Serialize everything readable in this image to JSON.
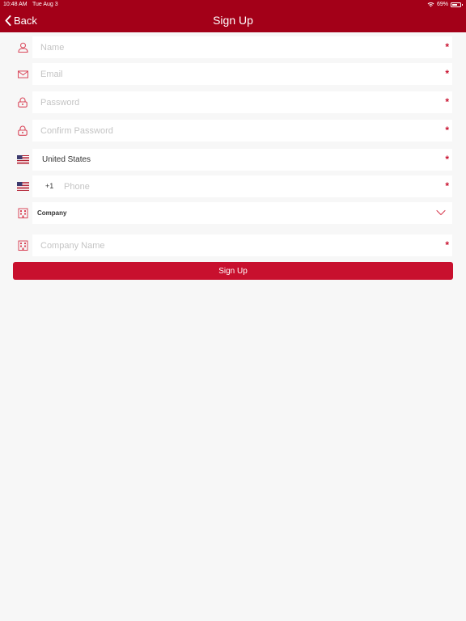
{
  "status_bar": {
    "time": "10:48 AM",
    "date": "Tue Aug 3",
    "battery": "69%",
    "battery_level": 0.69
  },
  "nav": {
    "back_label": "Back",
    "title": "Sign Up"
  },
  "form": {
    "name": {
      "placeholder": "Name",
      "required_mark": "*"
    },
    "email": {
      "placeholder": "Email",
      "required_mark": "*"
    },
    "password": {
      "placeholder": "Password",
      "required_mark": "*"
    },
    "confirm_password": {
      "placeholder": "Confirm Password",
      "required_mark": "*"
    },
    "country": {
      "value": "United States",
      "required_mark": "*"
    },
    "phone": {
      "country_code": "+1",
      "placeholder": "Phone",
      "required_mark": "*"
    },
    "account_type": {
      "selected": "Company"
    },
    "company_name": {
      "placeholder": "Company Name",
      "required_mark": "*"
    },
    "submit_label": "Sign Up"
  },
  "colors": {
    "header": "#a30018",
    "accent": "#c8102e",
    "icon": "#d9475a",
    "background": "#f7f7f7"
  },
  "icons": {
    "name": "person-icon",
    "email": "envelope-icon",
    "password": "lock-icon",
    "confirm_password": "lock-icon",
    "country": "us-flag-icon",
    "phone": "us-flag-icon",
    "account_type": "building-icon",
    "company_name": "building-icon",
    "dropdown": "chevron-down-icon",
    "back": "chevron-left-icon"
  }
}
